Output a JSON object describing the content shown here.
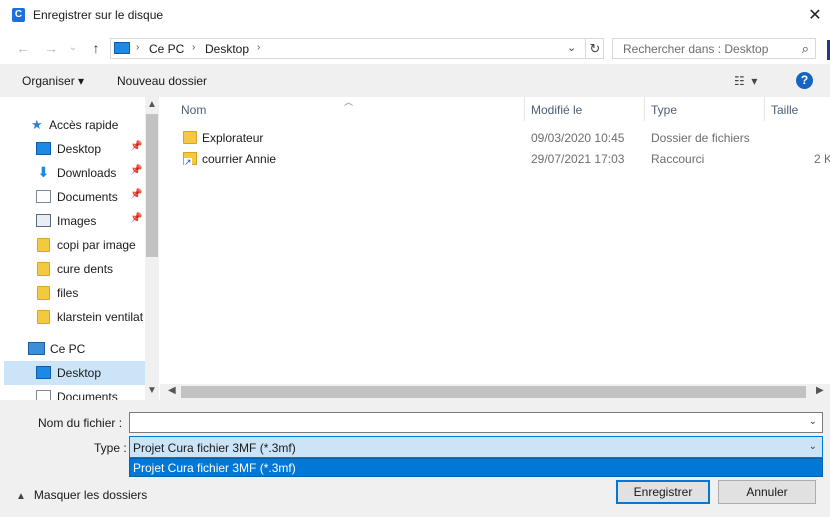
{
  "window": {
    "title": "Enregistrer sur le disque",
    "app_icon": "C",
    "close_label": "✕"
  },
  "nav": {
    "back": "←",
    "forward": "→",
    "recent": "⌄",
    "up": "↑",
    "breadcrumb": [
      "Ce PC",
      "Desktop"
    ],
    "search_placeholder": "Rechercher dans : Desktop"
  },
  "toolbar": {
    "organize": "Organiser ▾",
    "new_folder": "Nouveau dossier",
    "help": "?"
  },
  "sidebar": {
    "items": [
      {
        "label": "Accès rapide",
        "icon": "star-icon",
        "pinned": false
      },
      {
        "label": "Desktop",
        "icon": "desktop-icon",
        "pinned": true
      },
      {
        "label": "Downloads",
        "icon": "download-icon",
        "pinned": true
      },
      {
        "label": "Documents",
        "icon": "documents-icon",
        "pinned": true
      },
      {
        "label": "Images",
        "icon": "images-icon",
        "pinned": true
      },
      {
        "label": "copi par image",
        "icon": "folder-icon",
        "pinned": false
      },
      {
        "label": "cure dents",
        "icon": "folder-icon",
        "pinned": false
      },
      {
        "label": "files",
        "icon": "folder-icon",
        "pinned": false
      },
      {
        "label": "klarstein ventilat",
        "icon": "folder-icon",
        "pinned": false
      },
      {
        "label": "Ce PC",
        "icon": "computer-icon",
        "pinned": false
      },
      {
        "label": "Desktop",
        "icon": "desktop-icon",
        "pinned": false,
        "selected": true
      },
      {
        "label": "Documents",
        "icon": "documents-icon",
        "pinned": false
      }
    ]
  },
  "file_list": {
    "columns": [
      "Nom",
      "Modifié le",
      "Type",
      "Taille"
    ],
    "rows": [
      {
        "name": "Explorateur",
        "modified": "09/03/2020 10:45",
        "type": "Dossier de fichiers",
        "size": "",
        "icon": "folder-icon"
      },
      {
        "name": "courrier Annie",
        "modified": "29/07/2021 17:03",
        "type": "Raccourci",
        "size": "2 K",
        "icon": "shortcut-icon"
      }
    ]
  },
  "form": {
    "filename_label": "Nom du fichier :",
    "filename_value": "",
    "type_label": "Type :",
    "type_value": "Projet Cura fichier 3MF (*.3mf)",
    "type_options": [
      "Projet Cura fichier 3MF (*.3mf)"
    ]
  },
  "footer": {
    "hide_folders": "Masquer les dossiers",
    "save": "Enregistrer",
    "cancel": "Annuler"
  },
  "colors": {
    "accent": "#0078d7",
    "selection": "#cce4f7",
    "toolbar_bg": "#f0f0f0"
  }
}
